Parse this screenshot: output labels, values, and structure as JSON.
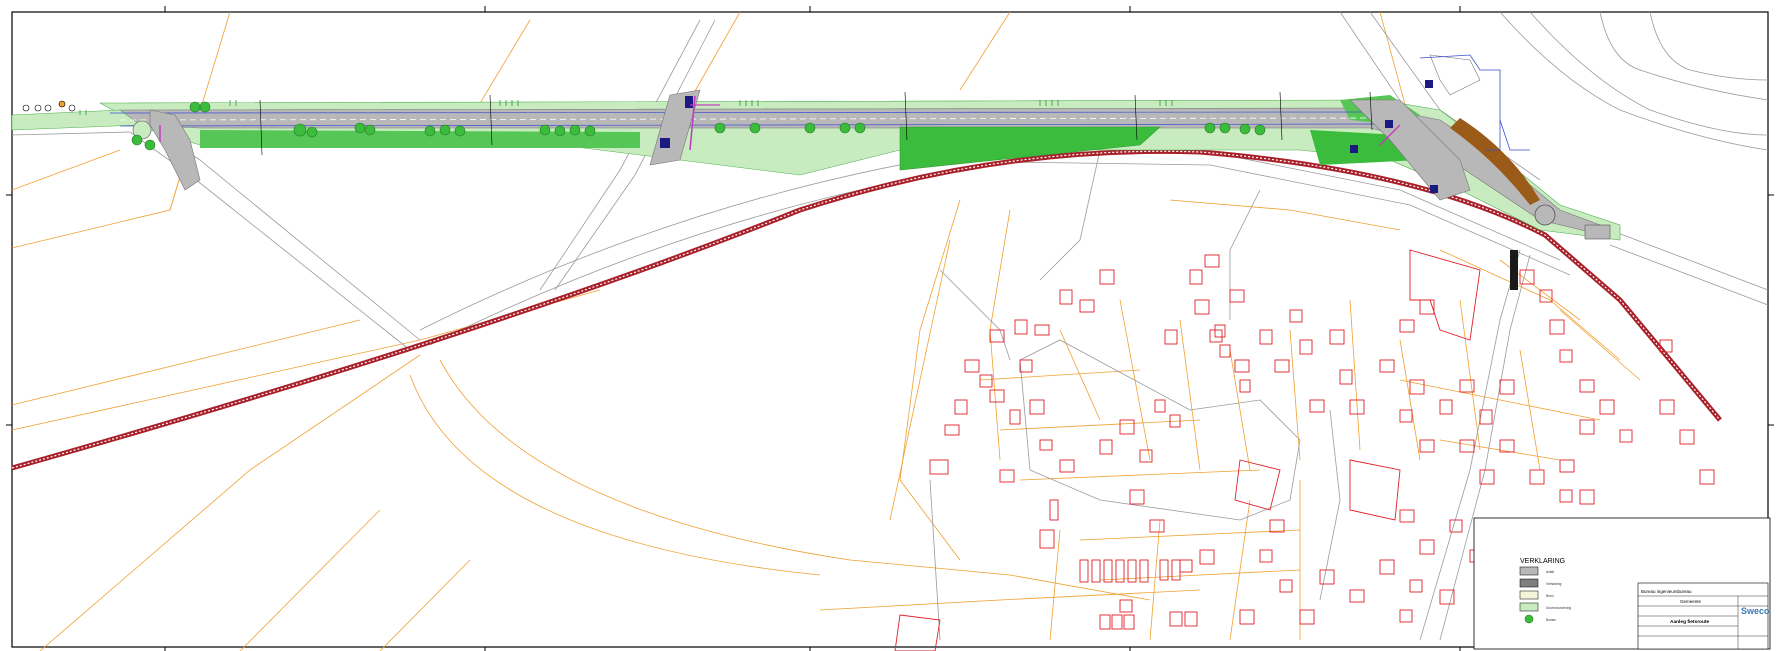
{
  "colors": {
    "parcel": "#f0a030",
    "building": "#e0202a",
    "road": "#9a9a9a",
    "green": "#3cbc3c",
    "light_green": "#b8e6b0",
    "rail": "#a8202a",
    "water": "#3a4fd0",
    "cycle": "#c23fc0",
    "brown": "#9a5a18"
  },
  "legend": {
    "title": "VERKLARING",
    "items": [
      {
        "swatch": "#b8b8b8",
        "label": "Asfalt"
      },
      {
        "swatch": "#7f7f7f",
        "label": "Verharding"
      },
      {
        "swatch": "#f4f4d8",
        "label": "Berm"
      },
      {
        "swatch": "#c8ecc0",
        "label": "Groenvoorziening"
      },
      {
        "swatch": "#3cbc3c",
        "label": "Bomen"
      }
    ]
  },
  "title_block": {
    "company": "Bureau ingenieursbureau",
    "client": "Gemeente",
    "project": "Aanleg fietsroute",
    "logo": "Sweco"
  },
  "icons": [
    "north-arrow-icon",
    "tree-icon"
  ]
}
